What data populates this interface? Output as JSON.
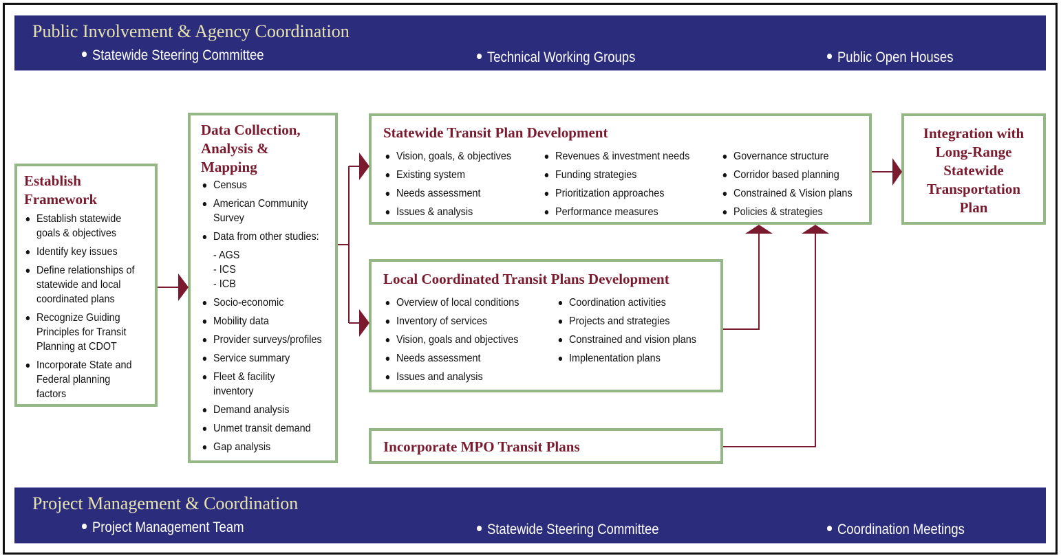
{
  "top_band": {
    "title": "Public Involvement & Agency Coordination",
    "items": [
      "Statewide Steering Committee",
      "Technical Working Groups",
      "Public Open Houses"
    ]
  },
  "bottom_band": {
    "title": "Project Management & Coordination",
    "items": [
      "Project Management Team",
      "Statewide Steering Committee",
      "Coordination Meetings"
    ]
  },
  "establish": {
    "title_line1": "Establish",
    "title_line2": "Framework",
    "items": [
      [
        "Establish statewide",
        "goals & objectives"
      ],
      [
        "Identify key issues"
      ],
      [
        "Define relationships of",
        "statewide and local",
        "coordinated plans"
      ],
      [
        "Recognize Guiding",
        "Principles for Transit",
        "Planning at CDOT"
      ],
      [
        "Incorporate State and",
        "Federal planning",
        "factors"
      ]
    ]
  },
  "data_collection": {
    "title_line1": "Data Collection,",
    "title_line2": "Analysis &",
    "title_line3": "Mapping",
    "items_a": [
      [
        "Census"
      ],
      [
        "American Community",
        "Survey"
      ],
      [
        "Data from other studies:"
      ]
    ],
    "sub_items": [
      "- AGS",
      "- ICS",
      "- ICB"
    ],
    "items_b": [
      [
        "Socio-economic"
      ],
      [
        "Mobility data"
      ],
      [
        "Provider surveys/profiles"
      ],
      [
        "Service summary"
      ],
      [
        "Fleet & facility",
        "inventory"
      ],
      [
        "Demand analysis"
      ],
      [
        "Unmet transit demand"
      ],
      [
        "Gap analysis"
      ]
    ]
  },
  "statewide_plan": {
    "title": "Statewide Transit Plan Development",
    "col1": [
      "Vision, goals, & objectives",
      "Existing system",
      "Needs assessment",
      "Issues & analysis"
    ],
    "col2": [
      "Revenues & investment needs",
      "Funding strategies",
      "Prioritization approaches",
      "Performance measures"
    ],
    "col3": [
      "Governance structure",
      "Corridor based planning",
      "Constrained & Vision plans",
      "Policies & strategies"
    ]
  },
  "integration": {
    "lines": [
      "Integration with",
      "Long-Range",
      "Statewide",
      "Transportation",
      "Plan"
    ]
  },
  "local_plans": {
    "title": "Local Coordinated Transit Plans Development",
    "col1": [
      "Overview of local conditions",
      "Inventory of services",
      "Vision, goals and objectives",
      "Needs assessment",
      "Issues and analysis"
    ],
    "col2": [
      "Coordination activities",
      "Projects and strategies",
      "Constrained and vision plans",
      "Implenentation plans"
    ]
  },
  "mpo": {
    "title": "Incorporate MPO Transit Plans"
  },
  "colors": {
    "band_bg": "#2b2d7c",
    "band_title": "#e8e4b0",
    "box_border": "#93b785",
    "accent": "#7a1a2e"
  }
}
